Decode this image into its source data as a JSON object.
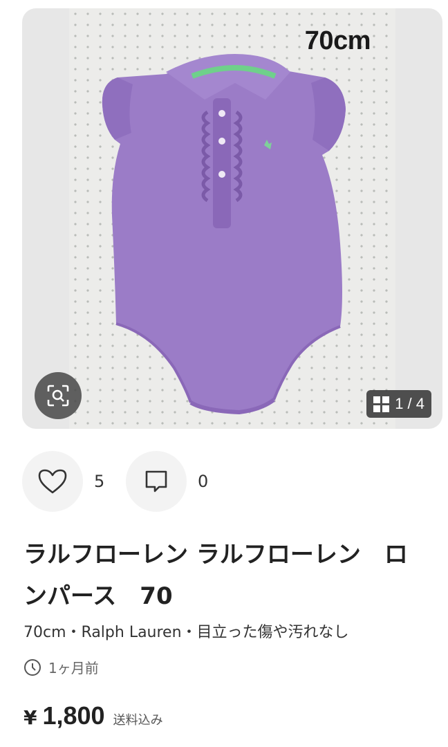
{
  "gallery": {
    "photo_caption": "70cm",
    "counter": "1 / 4",
    "colors": {
      "garment": "#9b7cc7",
      "collar_stripe": "#6fd08b"
    }
  },
  "actions": {
    "likes_count": "5",
    "comments_count": "0"
  },
  "product": {
    "title_line1": "ラルフローレン ラルフローレン　ロ",
    "title_line2": "ンパース　70",
    "tags": "70cm・Ralph Lauren・目立った傷や汚れなし",
    "posted": "1ヶ月前",
    "price_currency": "¥",
    "price_value": "1,800",
    "price_note": "送料込み"
  }
}
